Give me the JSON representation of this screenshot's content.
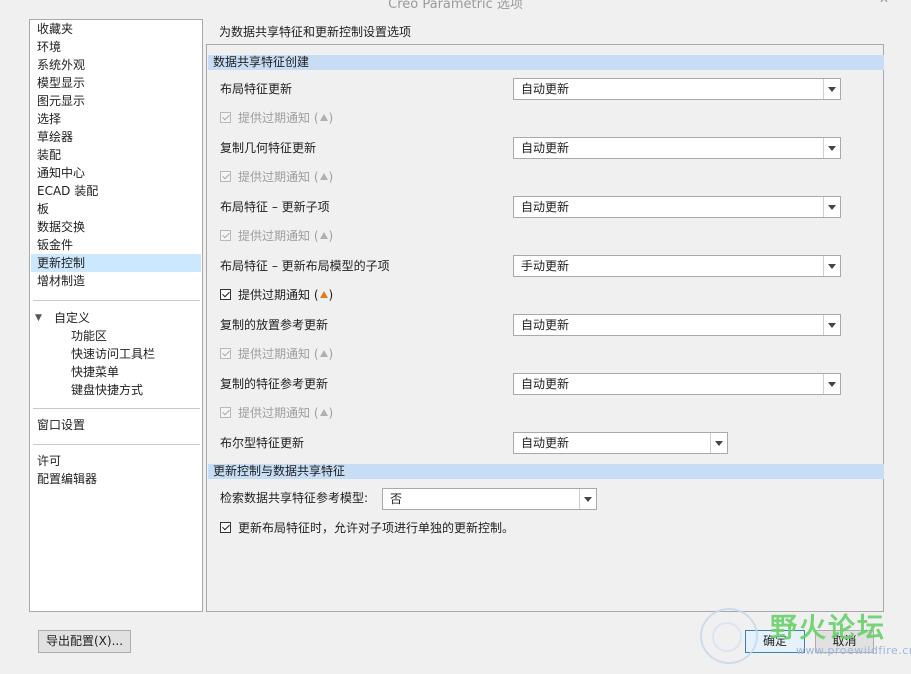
{
  "window": {
    "title": "Creo Parametric 选项",
    "close_glyph": "✕"
  },
  "nav": {
    "items": [
      "收藏夹",
      "环境",
      "系统外观",
      "模型显示",
      "图元显示",
      "选择",
      "草绘器",
      "装配",
      "通知中心",
      "ECAD 装配",
      "板",
      "数据交换",
      "钣金件",
      "更新控制",
      "增材制造"
    ],
    "selected": "更新控制",
    "custom_group": {
      "label": "自定义",
      "expand_glyph": "▼",
      "children": [
        "功能区",
        "快速访问工具栏",
        "快捷菜单",
        "键盘快捷方式"
      ]
    },
    "window_settings": "窗口设置",
    "license": "许可",
    "config_editor": "配置编辑器"
  },
  "page_title": "为数据共享特征和更新控制设置选项",
  "section1": {
    "header": "数据共享特征创建",
    "rows": [
      {
        "label": "布局特征更新",
        "value": "自动更新",
        "notify": "提供过期通知 (",
        "close": ")",
        "notify_checked": true,
        "notify_enabled": false
      },
      {
        "label": "复制几何特征更新",
        "value": "自动更新",
        "notify": "提供过期通知 (",
        "close": ")",
        "notify_checked": true,
        "notify_enabled": false
      },
      {
        "label": "布局特征 – 更新子项",
        "value": "自动更新",
        "notify": "提供过期通知 (",
        "close": ")",
        "notify_checked": true,
        "notify_enabled": false
      },
      {
        "label": "布局特征 – 更新布局模型的子项",
        "value": "手动更新",
        "notify": "提供过期通知 (",
        "close": ")",
        "notify_checked": true,
        "notify_enabled": true
      },
      {
        "label": "复制的放置参考更新",
        "value": "自动更新",
        "notify": "提供过期通知 (",
        "close": ")",
        "notify_checked": true,
        "notify_enabled": false
      },
      {
        "label": "复制的特征参考更新",
        "value": "自动更新",
        "notify": "提供过期通知 (",
        "close": ")",
        "notify_checked": true,
        "notify_enabled": false
      }
    ],
    "boolean_row": {
      "label": "布尔型特征更新",
      "value": "自动更新"
    }
  },
  "section2": {
    "header": "更新控制与数据共享特征",
    "retrieve_label": "检索数据共享特征参考模型:",
    "retrieve_value": "否",
    "allow_label": "更新布局特征时，允许对子项进行单独的更新控制。",
    "allow_checked": true
  },
  "footer": {
    "export": "导出配置(X)...",
    "ok": "确定",
    "cancel": "取消"
  },
  "watermark": {
    "cn": "野火论坛",
    "url": "www.proewildfire.cn"
  }
}
